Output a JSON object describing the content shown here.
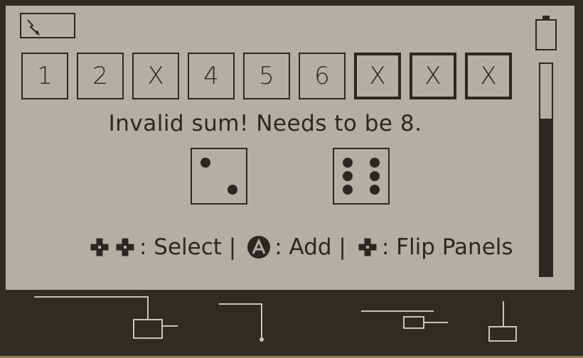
{
  "panels": [
    {
      "label": "1",
      "flipped": false
    },
    {
      "label": "2",
      "flipped": false
    },
    {
      "label": "X",
      "flipped": false
    },
    {
      "label": "4",
      "flipped": false
    },
    {
      "label": "5",
      "flipped": false
    },
    {
      "label": "6",
      "flipped": false
    },
    {
      "label": "X",
      "flipped": true
    },
    {
      "label": "X",
      "flipped": true
    },
    {
      "label": "X",
      "flipped": true
    }
  ],
  "message": "Invalid sum! Needs to be 8.",
  "dice": [
    2,
    6
  ],
  "controls": {
    "select_label": ": Select |",
    "add_label": ": Add |",
    "flip_label": ": Flip Panels"
  },
  "gauge_level": 0.74,
  "colors": {
    "screen": "#b2afa6",
    "ink": "#2b2823",
    "bezel": "#2f2b25",
    "circuit": "#c9c5ba"
  },
  "icons": [
    "battery-low-icon",
    "battery-icon",
    "dpad-icon",
    "a-button-icon"
  ]
}
